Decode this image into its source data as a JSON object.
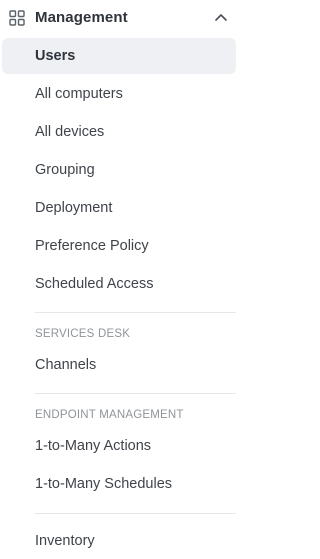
{
  "sidebar": {
    "section": {
      "title": "Management",
      "icon": "grid-icon",
      "toggle_icon": "chevron-up-icon"
    },
    "items": [
      {
        "label": "Users",
        "active": true
      },
      {
        "label": "All computers"
      },
      {
        "label": "All devices"
      },
      {
        "label": "Grouping"
      },
      {
        "label": "Deployment"
      },
      {
        "label": "Preference Policy"
      },
      {
        "label": "Scheduled Access"
      }
    ],
    "services_desk": {
      "label": "SERVICES DESK",
      "items": [
        {
          "label": "Channels"
        }
      ]
    },
    "endpoint_management": {
      "label": "ENDPOINT MANAGEMENT",
      "items": [
        {
          "label": "1-to-Many Actions"
        },
        {
          "label": "1-to-Many Schedules"
        }
      ]
    },
    "extra_items": [
      {
        "label": "Inventory"
      }
    ]
  },
  "colors": {
    "active_bg": "#eef0f4",
    "text": "#3f444b",
    "muted": "#8f949b",
    "divider": "#e5e7eb"
  }
}
